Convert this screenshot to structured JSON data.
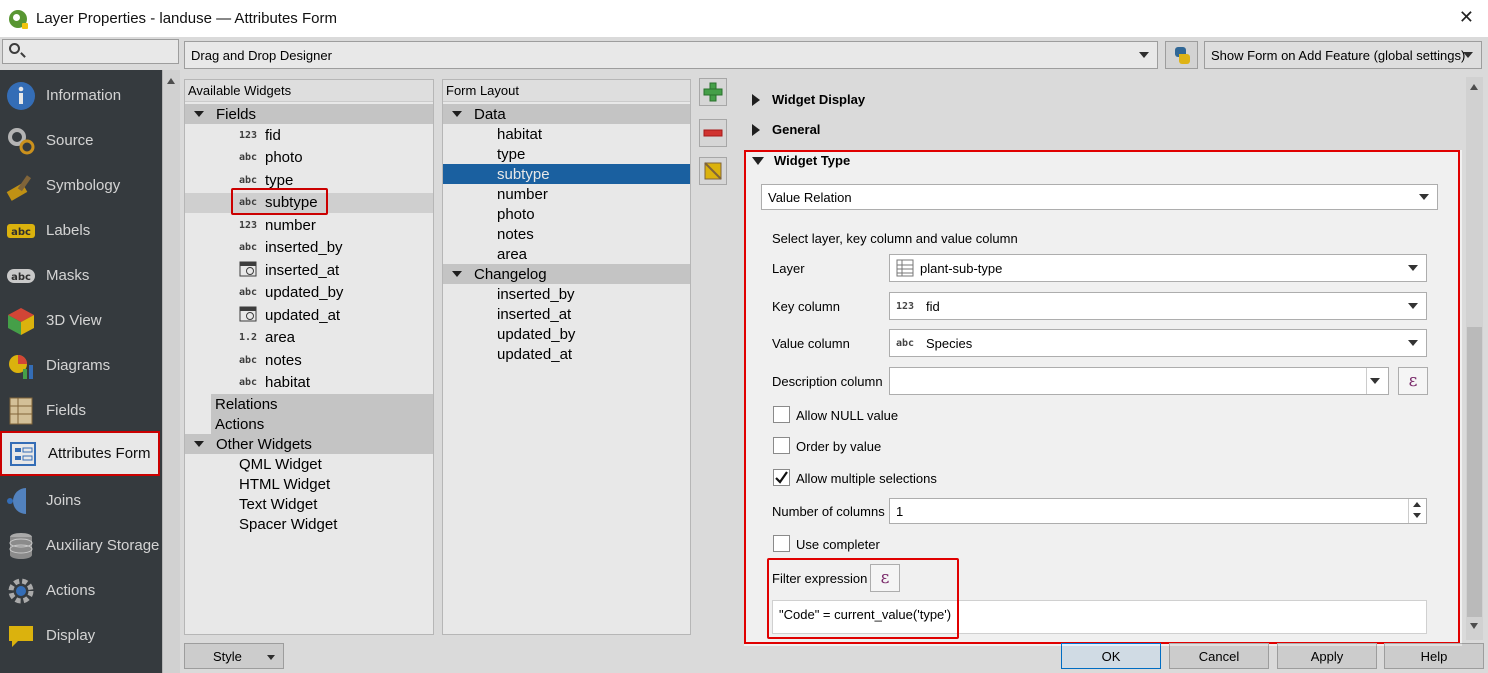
{
  "window": {
    "title": "Layer Properties - landuse — Attributes Form",
    "close_glyph": "✕"
  },
  "toolbar": {
    "designer_mode": "Drag and Drop Designer",
    "show_form_mode": "Show Form on Add Feature (global settings)"
  },
  "sidebar": {
    "items": [
      {
        "label": "Information",
        "icon": "information-icon",
        "color": "#3a78c9"
      },
      {
        "label": "Source",
        "icon": "source-icon",
        "color": "#c6c6c6"
      },
      {
        "label": "Symbology",
        "icon": "symbology-icon",
        "color": "#d4a017"
      },
      {
        "label": "Labels",
        "icon": "labels-icon",
        "color": "#f1c40f"
      },
      {
        "label": "Masks",
        "icon": "masks-icon",
        "color": "#dddddd"
      },
      {
        "label": "3D View",
        "icon": "3d-view-icon",
        "color": "#4caf50"
      },
      {
        "label": "Diagrams",
        "icon": "diagrams-icon",
        "color": "#e74c3c"
      },
      {
        "label": "Fields",
        "icon": "fields-icon",
        "color": "#c8a15a"
      },
      {
        "label": "Attributes Form",
        "icon": "attributes-form-icon",
        "color": "#3a78c9"
      },
      {
        "label": "Joins",
        "icon": "joins-icon",
        "color": "#3a78c9"
      },
      {
        "label": "Auxiliary Storage",
        "icon": "auxiliary-storage-icon",
        "color": "#bbbbbb"
      },
      {
        "label": "Actions",
        "icon": "actions-icon",
        "color": "#bbbbbb"
      },
      {
        "label": "Display",
        "icon": "display-icon",
        "color": "#f1c40f"
      }
    ],
    "selected_index": 8
  },
  "available_widgets": {
    "header": "Available Widgets",
    "fields_group": "Fields",
    "fields": [
      {
        "type": "123",
        "name": "fid"
      },
      {
        "type": "abc",
        "name": "photo"
      },
      {
        "type": "abc",
        "name": "type"
      },
      {
        "type": "abc",
        "name": "subtype"
      },
      {
        "type": "123",
        "name": "number"
      },
      {
        "type": "abc",
        "name": "inserted_by"
      },
      {
        "type": "date",
        "name": "inserted_at"
      },
      {
        "type": "abc",
        "name": "updated_by"
      },
      {
        "type": "date",
        "name": "updated_at"
      },
      {
        "type": "1.2",
        "name": "area"
      },
      {
        "type": "abc",
        "name": "notes"
      },
      {
        "type": "abc",
        "name": "habitat"
      }
    ],
    "relations_group": "Relations",
    "actions_group": "Actions",
    "other_group": "Other Widgets",
    "other_widgets": [
      "QML Widget",
      "HTML Widget",
      "Text Widget",
      "Spacer Widget"
    ]
  },
  "form_layout": {
    "header": "Form Layout",
    "data_group": "Data",
    "data_items": [
      "habitat",
      "type",
      "subtype",
      "number",
      "photo",
      "notes",
      "area"
    ],
    "changelog_group": "Changelog",
    "changelog_items": [
      "inserted_by",
      "inserted_at",
      "updated_by",
      "updated_at"
    ],
    "selected_item": "subtype"
  },
  "config": {
    "sections": {
      "widget_display": "Widget Display",
      "general": "General",
      "widget_type": "Widget Type"
    },
    "widget_type_value": "Value Relation",
    "select_hint": "Select layer, key column and value column",
    "layer_label": "Layer",
    "layer_value": "plant-sub-type",
    "key_label": "Key column",
    "key_type": "123",
    "key_value": "fid",
    "value_label": "Value column",
    "value_type": "abc",
    "value_value": "Species",
    "description_label": "Description column",
    "description_value": "",
    "allow_null_label": "Allow NULL value",
    "allow_null_checked": false,
    "order_by_label": "Order by value",
    "order_by_checked": false,
    "allow_multiple_label": "Allow multiple selections",
    "allow_multiple_checked": true,
    "columns_label": "Number of columns",
    "columns_value": "1",
    "completer_label": "Use completer",
    "completer_checked": false,
    "filter_label": "Filter expression",
    "filter_value": "\"Code\" = current_value('type')",
    "epsilon": "ε"
  },
  "footer": {
    "style": "Style",
    "ok": "OK",
    "cancel": "Cancel",
    "apply": "Apply",
    "help": "Help"
  }
}
